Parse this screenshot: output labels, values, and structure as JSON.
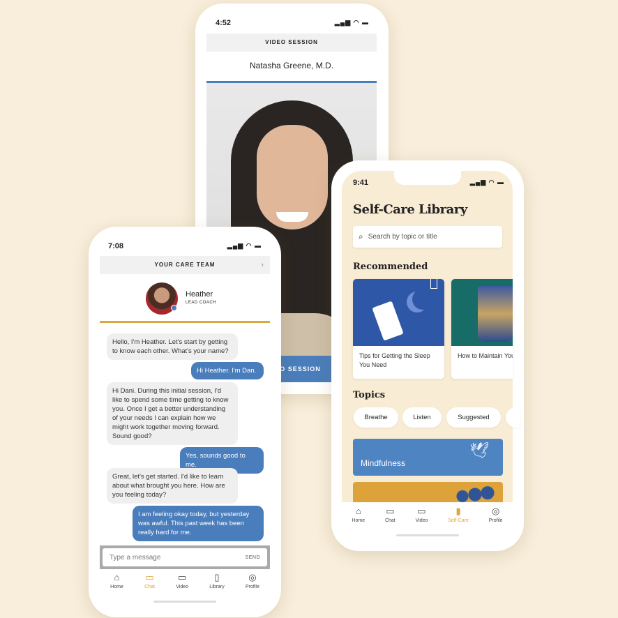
{
  "video_phone": {
    "time": "4:52",
    "header": "VIDEO SESSION",
    "doctor": "Natasha Greene, M.D.",
    "button": "VIDEO SESSION"
  },
  "chat_phone": {
    "time": "7:08",
    "header": "YOUR CARE TEAM",
    "coach_name": "Heather",
    "coach_role": "LEAD COACH",
    "messages": [
      {
        "from": "coach",
        "text": "Hello, I'm Heather. Let's start by getting to know each other. What's your name?"
      },
      {
        "from": "user",
        "text": "Hi Heather. I'm Dan."
      },
      {
        "from": "coach",
        "text": "Hi Dani. During this initial session, I'd like to spend some time getting to know you. Once I get a better understanding of your needs I can explain how we might work together moving forward. Sound good?"
      },
      {
        "from": "user",
        "text": "Yes, sounds good to me."
      },
      {
        "from": "coach",
        "text": "Great, let's get started. I'd like to learn about what brought you here. How are you feeling today?"
      },
      {
        "from": "user",
        "text": "I am feeling okay today, but yesterday was awful. This past week has been really hard for me."
      }
    ],
    "input_placeholder": "Type a message",
    "send": "SEND",
    "nav": [
      "Home",
      "Chat",
      "Video",
      "Library",
      "Profile"
    ],
    "active_nav": "Chat"
  },
  "selfcare_phone": {
    "time": "9:41",
    "title": "Self-Care Library",
    "search_placeholder": "Search by topic or title",
    "recommended_heading": "Recommended",
    "cards": [
      "Tips for Getting the Sleep You Need",
      "How to Maintain Your Optimism"
    ],
    "topics_heading": "Topics",
    "topics": [
      "Breathe",
      "Listen",
      "Suggested"
    ],
    "categories": [
      "Mindfulness"
    ],
    "nav": [
      "Home",
      "Chat",
      "Video",
      "Self-Care",
      "Profile"
    ],
    "active_nav": "Self-Care"
  },
  "colors": {
    "background": "#f8eedb",
    "accent": "#e0a23a",
    "blue": "#4a7dbb"
  }
}
